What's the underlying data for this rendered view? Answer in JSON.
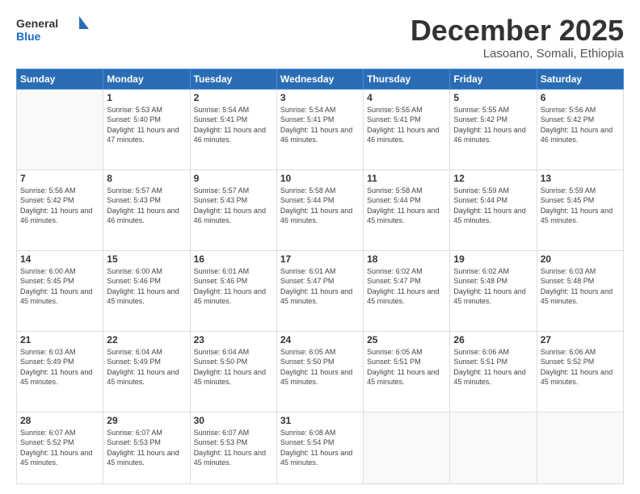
{
  "header": {
    "logo_general": "General",
    "logo_blue": "Blue",
    "month_title": "December 2025",
    "subtitle": "Lasoano, Somali, Ethiopia"
  },
  "weekdays": [
    "Sunday",
    "Monday",
    "Tuesday",
    "Wednesday",
    "Thursday",
    "Friday",
    "Saturday"
  ],
  "weeks": [
    [
      {
        "day": "",
        "sunrise": "",
        "sunset": "",
        "daylight": ""
      },
      {
        "day": "1",
        "sunrise": "Sunrise: 5:53 AM",
        "sunset": "Sunset: 5:40 PM",
        "daylight": "Daylight: 11 hours and 47 minutes."
      },
      {
        "day": "2",
        "sunrise": "Sunrise: 5:54 AM",
        "sunset": "Sunset: 5:41 PM",
        "daylight": "Daylight: 11 hours and 46 minutes."
      },
      {
        "day": "3",
        "sunrise": "Sunrise: 5:54 AM",
        "sunset": "Sunset: 5:41 PM",
        "daylight": "Daylight: 11 hours and 46 minutes."
      },
      {
        "day": "4",
        "sunrise": "Sunrise: 5:55 AM",
        "sunset": "Sunset: 5:41 PM",
        "daylight": "Daylight: 11 hours and 46 minutes."
      },
      {
        "day": "5",
        "sunrise": "Sunrise: 5:55 AM",
        "sunset": "Sunset: 5:42 PM",
        "daylight": "Daylight: 11 hours and 46 minutes."
      },
      {
        "day": "6",
        "sunrise": "Sunrise: 5:56 AM",
        "sunset": "Sunset: 5:42 PM",
        "daylight": "Daylight: 11 hours and 46 minutes."
      }
    ],
    [
      {
        "day": "7",
        "sunrise": "Sunrise: 5:56 AM",
        "sunset": "Sunset: 5:42 PM",
        "daylight": "Daylight: 11 hours and 46 minutes."
      },
      {
        "day": "8",
        "sunrise": "Sunrise: 5:57 AM",
        "sunset": "Sunset: 5:43 PM",
        "daylight": "Daylight: 11 hours and 46 minutes."
      },
      {
        "day": "9",
        "sunrise": "Sunrise: 5:57 AM",
        "sunset": "Sunset: 5:43 PM",
        "daylight": "Daylight: 11 hours and 46 minutes."
      },
      {
        "day": "10",
        "sunrise": "Sunrise: 5:58 AM",
        "sunset": "Sunset: 5:44 PM",
        "daylight": "Daylight: 11 hours and 46 minutes."
      },
      {
        "day": "11",
        "sunrise": "Sunrise: 5:58 AM",
        "sunset": "Sunset: 5:44 PM",
        "daylight": "Daylight: 11 hours and 45 minutes."
      },
      {
        "day": "12",
        "sunrise": "Sunrise: 5:59 AM",
        "sunset": "Sunset: 5:44 PM",
        "daylight": "Daylight: 11 hours and 45 minutes."
      },
      {
        "day": "13",
        "sunrise": "Sunrise: 5:59 AM",
        "sunset": "Sunset: 5:45 PM",
        "daylight": "Daylight: 11 hours and 45 minutes."
      }
    ],
    [
      {
        "day": "14",
        "sunrise": "Sunrise: 6:00 AM",
        "sunset": "Sunset: 5:45 PM",
        "daylight": "Daylight: 11 hours and 45 minutes."
      },
      {
        "day": "15",
        "sunrise": "Sunrise: 6:00 AM",
        "sunset": "Sunset: 5:46 PM",
        "daylight": "Daylight: 11 hours and 45 minutes."
      },
      {
        "day": "16",
        "sunrise": "Sunrise: 6:01 AM",
        "sunset": "Sunset: 5:46 PM",
        "daylight": "Daylight: 11 hours and 45 minutes."
      },
      {
        "day": "17",
        "sunrise": "Sunrise: 6:01 AM",
        "sunset": "Sunset: 5:47 PM",
        "daylight": "Daylight: 11 hours and 45 minutes."
      },
      {
        "day": "18",
        "sunrise": "Sunrise: 6:02 AM",
        "sunset": "Sunset: 5:47 PM",
        "daylight": "Daylight: 11 hours and 45 minutes."
      },
      {
        "day": "19",
        "sunrise": "Sunrise: 6:02 AM",
        "sunset": "Sunset: 5:48 PM",
        "daylight": "Daylight: 11 hours and 45 minutes."
      },
      {
        "day": "20",
        "sunrise": "Sunrise: 6:03 AM",
        "sunset": "Sunset: 5:48 PM",
        "daylight": "Daylight: 11 hours and 45 minutes."
      }
    ],
    [
      {
        "day": "21",
        "sunrise": "Sunrise: 6:03 AM",
        "sunset": "Sunset: 5:49 PM",
        "daylight": "Daylight: 11 hours and 45 minutes."
      },
      {
        "day": "22",
        "sunrise": "Sunrise: 6:04 AM",
        "sunset": "Sunset: 5:49 PM",
        "daylight": "Daylight: 11 hours and 45 minutes."
      },
      {
        "day": "23",
        "sunrise": "Sunrise: 6:04 AM",
        "sunset": "Sunset: 5:50 PM",
        "daylight": "Daylight: 11 hours and 45 minutes."
      },
      {
        "day": "24",
        "sunrise": "Sunrise: 6:05 AM",
        "sunset": "Sunset: 5:50 PM",
        "daylight": "Daylight: 11 hours and 45 minutes."
      },
      {
        "day": "25",
        "sunrise": "Sunrise: 6:05 AM",
        "sunset": "Sunset: 5:51 PM",
        "daylight": "Daylight: 11 hours and 45 minutes."
      },
      {
        "day": "26",
        "sunrise": "Sunrise: 6:06 AM",
        "sunset": "Sunset: 5:51 PM",
        "daylight": "Daylight: 11 hours and 45 minutes."
      },
      {
        "day": "27",
        "sunrise": "Sunrise: 6:06 AM",
        "sunset": "Sunset: 5:52 PM",
        "daylight": "Daylight: 11 hours and 45 minutes."
      }
    ],
    [
      {
        "day": "28",
        "sunrise": "Sunrise: 6:07 AM",
        "sunset": "Sunset: 5:52 PM",
        "daylight": "Daylight: 11 hours and 45 minutes."
      },
      {
        "day": "29",
        "sunrise": "Sunrise: 6:07 AM",
        "sunset": "Sunset: 5:53 PM",
        "daylight": "Daylight: 11 hours and 45 minutes."
      },
      {
        "day": "30",
        "sunrise": "Sunrise: 6:07 AM",
        "sunset": "Sunset: 5:53 PM",
        "daylight": "Daylight: 11 hours and 45 minutes."
      },
      {
        "day": "31",
        "sunrise": "Sunrise: 6:08 AM",
        "sunset": "Sunset: 5:54 PM",
        "daylight": "Daylight: 11 hours and 45 minutes."
      },
      {
        "day": "",
        "sunrise": "",
        "sunset": "",
        "daylight": ""
      },
      {
        "day": "",
        "sunrise": "",
        "sunset": "",
        "daylight": ""
      },
      {
        "day": "",
        "sunrise": "",
        "sunset": "",
        "daylight": ""
      }
    ]
  ]
}
